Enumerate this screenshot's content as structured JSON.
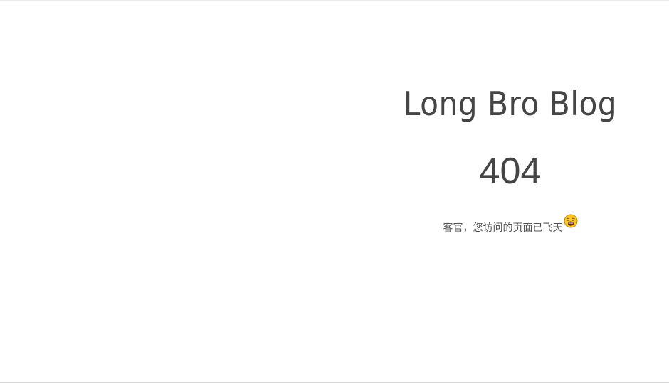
{
  "site": {
    "title": "Long Bro Blog"
  },
  "error": {
    "code": "404",
    "message": "客官，您访问的页面已飞天",
    "emoji_icon": "astonished-face-icon"
  },
  "colors": {
    "text": "#454545",
    "emoji_face": "#f5c518"
  }
}
